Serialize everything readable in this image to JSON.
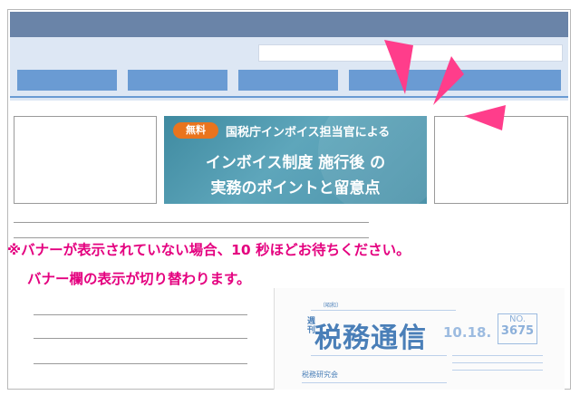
{
  "banner": {
    "badge": "無料",
    "headline_top": "国税庁インボイス担当官による",
    "line1": "インボイス制度 施行後 の",
    "line2": "実務のポイントと留意点",
    "colors": {
      "background": "#4d93aa",
      "badge": "#e9741e"
    }
  },
  "notice": {
    "line1": "※バナーが表示されていない場合、10 秒ほどお待ちください。",
    "line2": "バナー欄の表示が切り替わります。",
    "color": "#e4007f"
  },
  "newspaper": {
    "prefix": "週刊",
    "title": "税務通信",
    "date": "10.18.",
    "number_label": "NO.",
    "number": "3675",
    "publisher": "税務研究会"
  },
  "colors": {
    "header_bar": "#6a84a8",
    "nav": "#6a9bd3",
    "header_band": "#dde7f4",
    "arrows": "#ff3d8b"
  }
}
